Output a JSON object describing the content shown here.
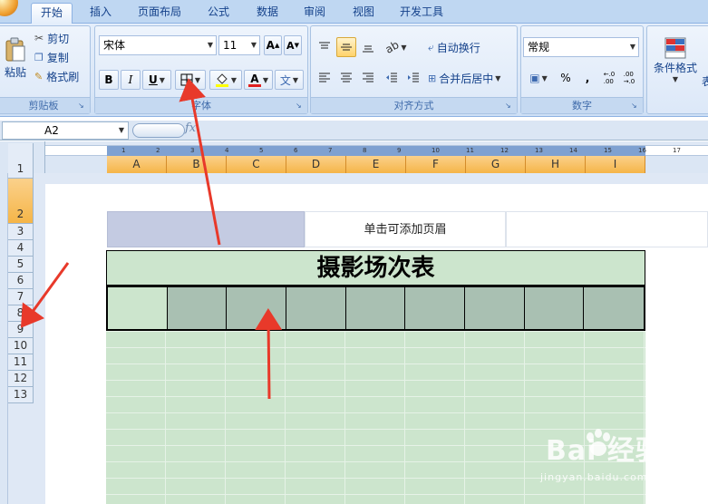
{
  "tabs": [
    {
      "label": "开始",
      "active": true
    },
    {
      "label": "插入"
    },
    {
      "label": "页面布局"
    },
    {
      "label": "公式"
    },
    {
      "label": "数据"
    },
    {
      "label": "审阅"
    },
    {
      "label": "视图"
    },
    {
      "label": "开发工具"
    }
  ],
  "clipboard": {
    "paste_label": "粘贴",
    "cut_label": "剪切",
    "copy_label": "复制",
    "format_painter_label": "格式刷",
    "group_label": "剪贴板"
  },
  "font": {
    "font_name": "宋体",
    "font_size": "11",
    "grow_label": "A",
    "shrink_label": "A",
    "bold_label": "B",
    "italic_label": "I",
    "underline_label": "U",
    "font_color_label": "A",
    "phonetic_label": "文",
    "group_label": "字体"
  },
  "alignment": {
    "wrap_text_label": "自动换行",
    "merge_center_label": "合并后居中",
    "group_label": "对齐方式"
  },
  "number": {
    "format_value": "常规",
    "percent_label": "%",
    "comma_label": ",",
    "group_label": "数字"
  },
  "styles": {
    "conditional_format_label": "条件格式",
    "overflow_char": "表"
  },
  "formula_bar": {
    "name_box": "A2",
    "fx_label": "fx"
  },
  "ruler_numbers": [
    "1",
    "2",
    "3",
    "4",
    "5",
    "6",
    "7",
    "8",
    "9",
    "10",
    "11",
    "12",
    "13",
    "14",
    "15",
    "16",
    "17"
  ],
  "columns": [
    "A",
    "B",
    "C",
    "D",
    "E",
    "F",
    "G",
    "H",
    "I"
  ],
  "rows": [
    "1",
    "2",
    "3",
    "4",
    "5",
    "6",
    "7",
    "8",
    "9",
    "10",
    "11",
    "12",
    "13"
  ],
  "selected_row": "2",
  "page_header": {
    "center_text": "单击可添加页眉"
  },
  "sheet": {
    "title": "摄影场次表"
  },
  "watermark": {
    "brand": "Bai 经验",
    "url": "jingyan.baidu.com"
  },
  "colors": {
    "tab_bar": "#bfd7f2",
    "ribbon": "#dbe7f7",
    "column_header_selected": "#f5b548",
    "title_fill": "#cce5cd",
    "row2_fill": "#a9c0b2",
    "arrow": "#e8392a"
  }
}
